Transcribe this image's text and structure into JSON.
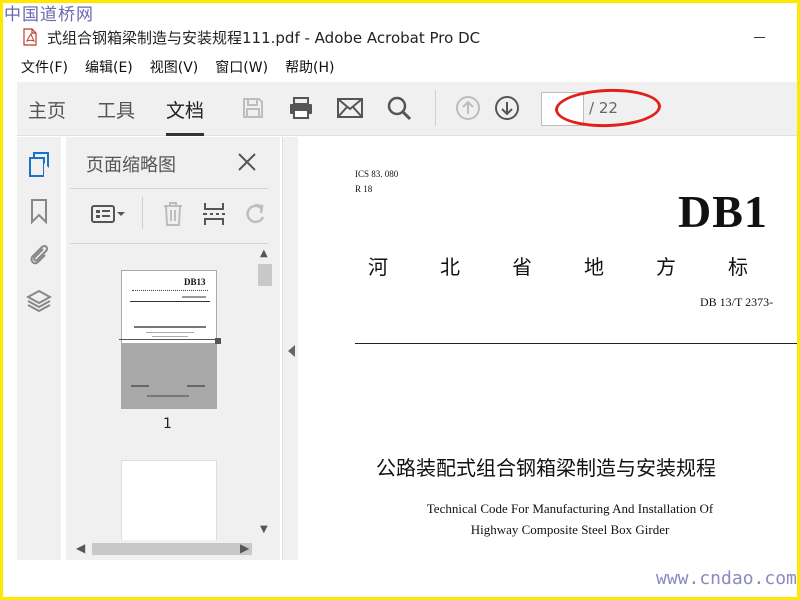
{
  "watermark": {
    "top": "中国道桥网",
    "bottom": "www.cndao.com"
  },
  "window": {
    "title": "式组合钢箱梁制造与安装规程111.pdf - Adobe Acrobat Pro DC"
  },
  "menu": [
    "文件(F)",
    "编辑(E)",
    "视图(V)",
    "窗口(W)",
    "帮助(H)"
  ],
  "tabs": {
    "home": "主页",
    "tools": "工具",
    "document": "文档"
  },
  "toolbar": {
    "icons": [
      "save-icon",
      "print-icon",
      "email-icon",
      "search-icon",
      "prev-page-icon",
      "next-page-icon"
    ],
    "page_input": "",
    "page_total": "/ 22"
  },
  "panel": {
    "title": "页面缩略图",
    "thumbnail_label": "1",
    "thumb_db": "DB13"
  },
  "document": {
    "ics_line1": "ICS  83. 080",
    "ics_line2": "R  18",
    "db_code": "DB1",
    "province_chars": [
      "河",
      "北",
      "省",
      "地",
      "方",
      "标"
    ],
    "standard_no": "DB 13/T  2373-",
    "title_cn": "公路装配式组合钢箱梁制造与安装规程",
    "title_en_1": "Technical Code For Manufacturing And Installation Of",
    "title_en_2": "Highway Composite Steel Box Girder"
  },
  "colors": {
    "accent_blue": "#1a73c8",
    "highlight_red": "#e0211b",
    "frame_yellow": "#ffe800"
  }
}
